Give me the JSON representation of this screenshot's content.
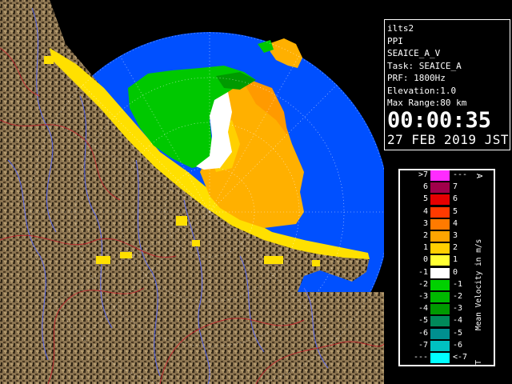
{
  "info": {
    "radar_name": "ilts2",
    "product": "PPI",
    "dataset": "SEAICE_A_V",
    "task": "Task: SEAICE_A",
    "prf": "PRF: 1800Hz",
    "elevation": "Elevation:1.0",
    "max_range": "Max Range:80 km",
    "time": "00:00:35",
    "date": "27 FEB 2019 JST"
  },
  "scale": {
    "title": "Mean Velocity in m/s",
    "top_letter": "A",
    "bottom_letter": "T",
    "rows": [
      {
        "left": ">7",
        "right": "---",
        "color": "#ff2bff"
      },
      {
        "left": "6",
        "right": "7",
        "color": "#a0004a"
      },
      {
        "left": "5",
        "right": "6",
        "color": "#e60000"
      },
      {
        "left": "4",
        "right": "5",
        "color": "#ff3a00"
      },
      {
        "left": "3",
        "right": "4",
        "color": "#ff7a00"
      },
      {
        "left": "2",
        "right": "3",
        "color": "#ffa500"
      },
      {
        "left": "1",
        "right": "2",
        "color": "#ffd000"
      },
      {
        "left": "0",
        "right": "1",
        "color": "#ffff33"
      },
      {
        "left": "-1",
        "right": "0",
        "color": "#ffffff"
      },
      {
        "left": "-2",
        "right": "-1",
        "color": "#00d100"
      },
      {
        "left": "-3",
        "right": "-2",
        "color": "#00b800"
      },
      {
        "left": "-4",
        "right": "-3",
        "color": "#009a00"
      },
      {
        "left": "-5",
        "right": "-4",
        "color": "#008a5a"
      },
      {
        "left": "-6",
        "right": "-5",
        "color": "#008f8f"
      },
      {
        "left": "-7",
        "right": "-6",
        "color": "#00c0c0"
      },
      {
        "left": "---",
        "right": "<-7",
        "color": "#00ffff"
      }
    ]
  },
  "colors": {
    "sea": "#0050ff",
    "range_ring": "#ffffff",
    "land": "#8a7350",
    "land_dark": "#3b2e1c",
    "river": "#5a6cff",
    "boundary": "#c0202a",
    "approaching": "#00c800",
    "receding": "#ffb000",
    "zero": "#ffffff",
    "coast_echo": "#ffff00"
  }
}
